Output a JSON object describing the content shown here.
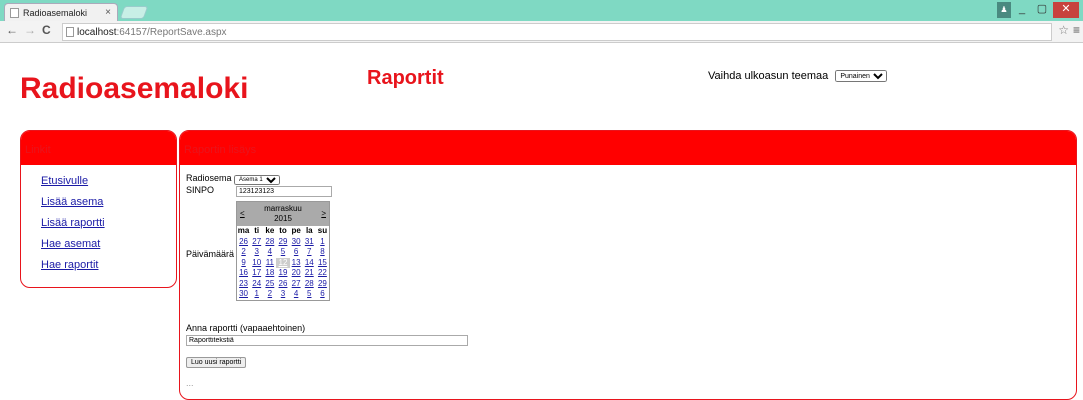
{
  "browser": {
    "tab_title": "Radioasemaloki",
    "tab_close": "×",
    "url_host": "localhost",
    "url_rest": ":64157/ReportSave.aspx",
    "back": "←",
    "forward": "→",
    "reload": "C",
    "star": "☆",
    "menu": "≡",
    "win_user": "♟",
    "win_min": "_",
    "win_max": "▢",
    "win_close": "✕"
  },
  "header": {
    "site_title": "Radioasemaloki",
    "page_heading": "Raportit",
    "theme_label": "Vaihda ulkoasun teemaa",
    "theme_value": "Punainen"
  },
  "links": {
    "heading": "Linkit",
    "items": [
      "Etusivulle",
      "Lisää asema",
      "Lisää raportti",
      "Hae asemat",
      "Hae raportit"
    ]
  },
  "form": {
    "heading": "Raportin lisäys",
    "station_label": "Radiosema",
    "station_value": "Asema 1",
    "sinpo_label": "SINPO",
    "sinpo_value": "123123123",
    "date_label": "Päivämäärä",
    "report_label": "Anna raportti (vapaaehtoinen)",
    "report_value": "Raporttitekstiä",
    "submit_label": "Luo uusi raportti",
    "footer": "..."
  },
  "calendar": {
    "month": "marraskuu",
    "year": "2015",
    "prev": "<",
    "next": ">",
    "day_names": [
      "ma",
      "ti",
      "ke",
      "to",
      "pe",
      "la",
      "su"
    ],
    "weeks": [
      [
        "26",
        "27",
        "28",
        "29",
        "30",
        "31",
        "1"
      ],
      [
        "2",
        "3",
        "4",
        "5",
        "6",
        "7",
        "8"
      ],
      [
        "9",
        "10",
        "11",
        "12",
        "13",
        "14",
        "15"
      ],
      [
        "16",
        "17",
        "18",
        "19",
        "20",
        "21",
        "22"
      ],
      [
        "23",
        "24",
        "25",
        "26",
        "27",
        "28",
        "29"
      ],
      [
        "30",
        "1",
        "2",
        "3",
        "4",
        "5",
        "6"
      ]
    ],
    "selected": "12"
  }
}
